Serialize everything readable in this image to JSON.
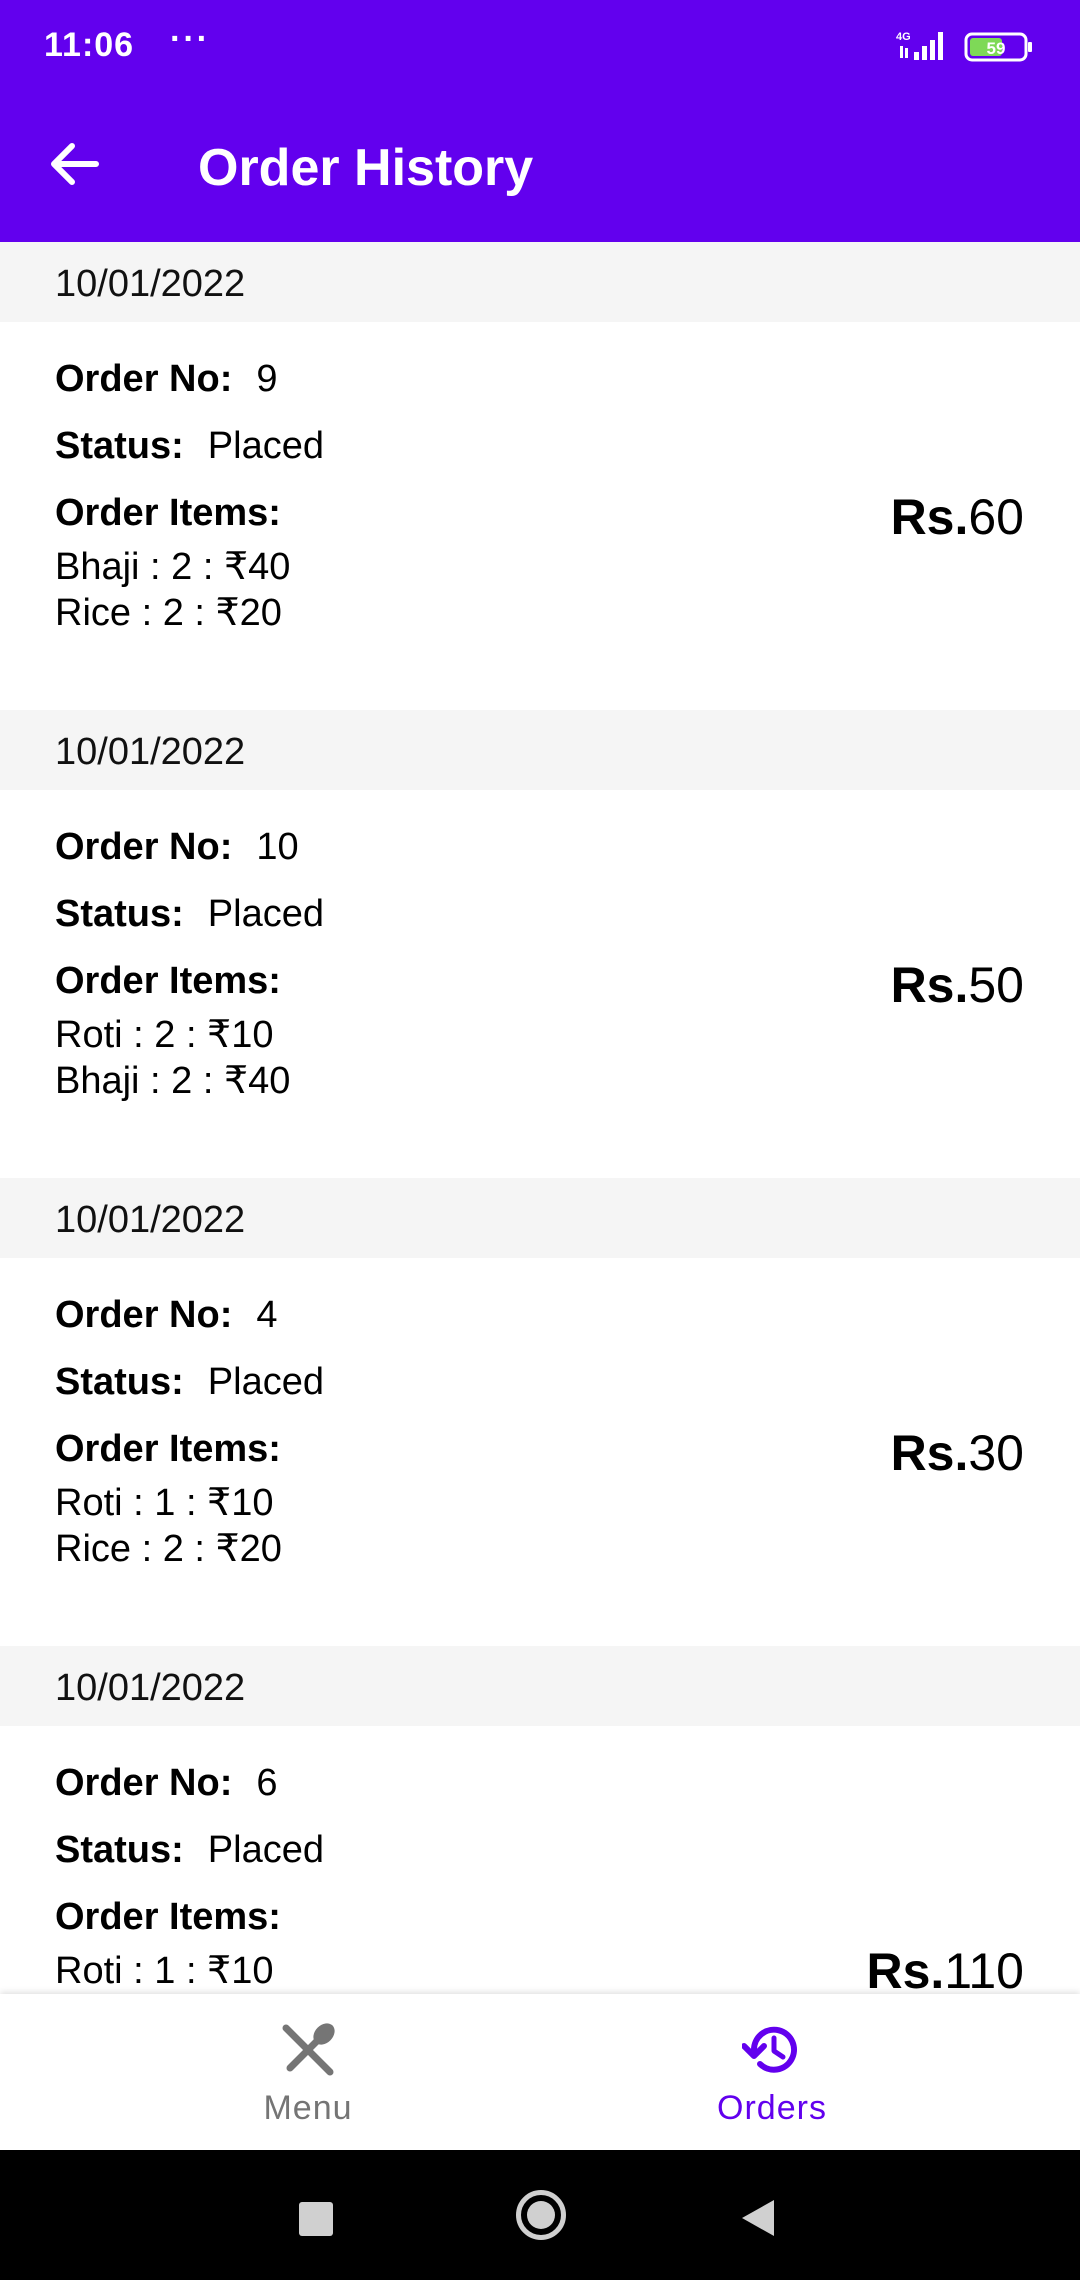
{
  "status_bar": {
    "time": "11:06",
    "more": "···",
    "network": "4G",
    "battery": "59"
  },
  "app_bar": {
    "title": "Order History"
  },
  "labels": {
    "order_no": "Order No:",
    "status": "Status:",
    "order_items": "Order Items:",
    "currency": "Rs."
  },
  "orders": [
    {
      "date": "10/01/2022",
      "order_no": "9",
      "status": "Placed",
      "items": [
        "Bhaji : 2 : ₹40",
        "Rice : 2 : ₹20"
      ],
      "total": "60"
    },
    {
      "date": "10/01/2022",
      "order_no": "10",
      "status": "Placed",
      "items": [
        "Roti : 2 : ₹10",
        "Bhaji : 2 : ₹40"
      ],
      "total": "50"
    },
    {
      "date": "10/01/2022",
      "order_no": "4",
      "status": "Placed",
      "items": [
        "Roti : 1 : ₹10",
        "Rice : 2 : ₹20"
      ],
      "total": "30"
    },
    {
      "date": "10/01/2022",
      "order_no": "6",
      "status": "Placed",
      "items": [
        "Roti : 1 : ₹10"
      ],
      "total": "110"
    }
  ],
  "bottom_nav": [
    {
      "label": "Menu",
      "icon": "fork-knife-icon",
      "active": false
    },
    {
      "label": "Orders",
      "icon": "history-icon",
      "active": true
    }
  ],
  "colors": {
    "primary": "#6200ee",
    "inactive": "#757575",
    "date_bg": "#f5f5f5"
  }
}
